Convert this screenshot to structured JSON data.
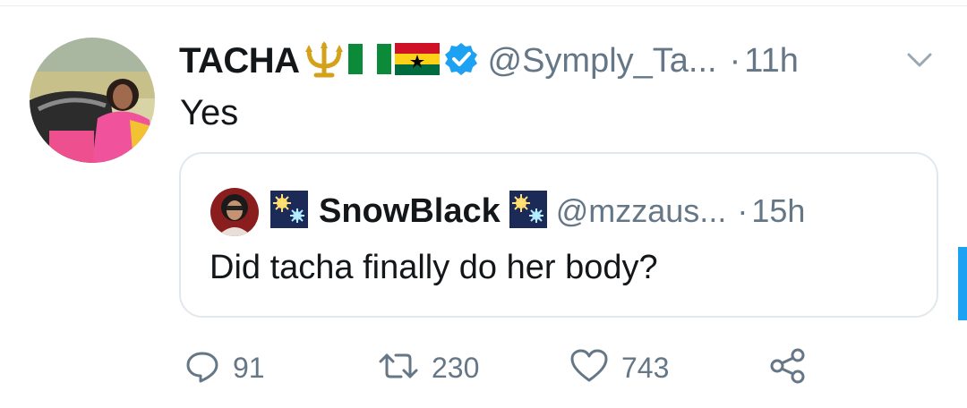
{
  "tweet": {
    "display_name": "TACHA",
    "name_emojis": [
      "trident-icon",
      "nigeria-flag-icon",
      "ghana-flag-icon"
    ],
    "verified": true,
    "handle": "@Symply_Ta...",
    "separator": "·",
    "time": "11h",
    "text": "Yes"
  },
  "quote": {
    "display_name": "SnowBlack",
    "handle": "@mzzaus...",
    "separator": "·",
    "time": "15h",
    "text": "Did tacha finally do her body?"
  },
  "actions": {
    "replies": "91",
    "retweets": "230",
    "likes": "743"
  },
  "colors": {
    "text": "#14171a",
    "secondary": "#657786",
    "verified": "#1da1f2",
    "border": "#e1e8ed",
    "scrollbar": "#1da1f2"
  }
}
